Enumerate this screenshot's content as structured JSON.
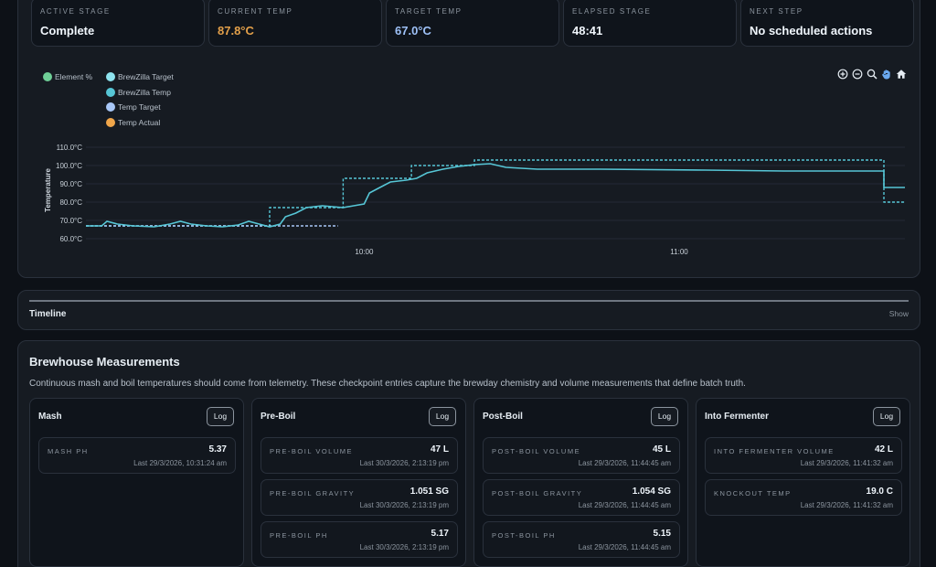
{
  "stats": [
    {
      "label": "Active Stage",
      "value": "Complete",
      "color": "#f0f6fc"
    },
    {
      "label": "Current Temp",
      "value": "87.8°C",
      "color": "#e3a04a"
    },
    {
      "label": "Target Temp",
      "value": "67.0°C",
      "color": "#9ec1f7"
    },
    {
      "label": "Elapsed Stage",
      "value": "48:41",
      "color": "#f0f6fc"
    },
    {
      "label": "Next Step",
      "value": "No scheduled actions",
      "color": "#f0f6fc"
    }
  ],
  "legend": [
    {
      "label": "Element %",
      "color": "#6fcf97"
    },
    {
      "label": "BrewZilla Target",
      "color": "#8ee3ef"
    },
    {
      "label": "BrewZilla Temp",
      "color": "#56c6d6"
    },
    {
      "label": "Temp Target",
      "color": "#a8c7f7"
    },
    {
      "label": "Temp Actual",
      "color": "#f0a64a"
    }
  ],
  "toolbar": {
    "icons": [
      "zoom-in-icon",
      "zoom-out-icon",
      "zoom-select-icon",
      "pan-icon",
      "home-icon"
    ]
  },
  "chart_data": {
    "type": "line",
    "ylabel": "Temperature",
    "ylim": [
      60,
      110
    ],
    "yticks": [
      "110.0°C",
      "100.0°C",
      "90.0°C",
      "80.0°C",
      "70.0°C",
      "60.0°C"
    ],
    "yvalues": [
      110,
      100,
      90,
      80,
      70,
      60
    ],
    "xlim": [
      "09:07",
      "11:43"
    ],
    "xticks": [
      {
        "label": "10:00",
        "t": "10:00"
      },
      {
        "label": "11:00",
        "t": "11:00"
      }
    ],
    "series": [
      {
        "name": "BrewZilla Target",
        "style": "dashed",
        "color": "#56c6d6",
        "points": [
          [
            "09:07",
            67
          ],
          [
            "09:42",
            67
          ],
          [
            "09:42",
            77
          ],
          [
            "09:56",
            77
          ],
          [
            "09:56",
            93
          ],
          [
            "10:09",
            93
          ],
          [
            "10:09",
            100
          ],
          [
            "10:21",
            100
          ],
          [
            "10:21",
            103
          ],
          [
            "11:39",
            103
          ],
          [
            "11:39",
            80
          ],
          [
            "11:43",
            80
          ]
        ]
      },
      {
        "name": "Temp Target",
        "style": "dashed",
        "color": "#a8c7f7",
        "points": [
          [
            "09:07",
            67
          ],
          [
            "09:55",
            67
          ]
        ]
      },
      {
        "name": "BrewZilla Temp",
        "style": "solid",
        "color": "#56c6d6",
        "points": [
          [
            "09:07",
            67
          ],
          [
            "09:10",
            67
          ],
          [
            "09:11",
            69.5
          ],
          [
            "09:13",
            68
          ],
          [
            "09:16",
            67
          ],
          [
            "09:20",
            66.5
          ],
          [
            "09:23",
            68
          ],
          [
            "09:25",
            69.5
          ],
          [
            "09:27",
            68
          ],
          [
            "09:30",
            67
          ],
          [
            "09:33",
            66.5
          ],
          [
            "09:36",
            67.5
          ],
          [
            "09:38",
            69.5
          ],
          [
            "09:40",
            68
          ],
          [
            "09:42",
            66.5
          ],
          [
            "09:44",
            68
          ],
          [
            "09:45",
            72
          ],
          [
            "09:47",
            74
          ],
          [
            "09:49",
            77
          ],
          [
            "09:52",
            78
          ],
          [
            "09:54",
            77.5
          ],
          [
            "09:56",
            77
          ],
          [
            "09:58",
            78
          ],
          [
            "10:00",
            79
          ],
          [
            "10:01",
            85
          ],
          [
            "10:03",
            88
          ],
          [
            "10:05",
            91
          ],
          [
            "10:08",
            92
          ],
          [
            "10:10",
            93
          ],
          [
            "10:12",
            96
          ],
          [
            "10:15",
            98
          ],
          [
            "10:18",
            99.5
          ],
          [
            "10:21",
            100.5
          ],
          [
            "10:24",
            101
          ],
          [
            "10:27",
            99
          ],
          [
            "10:33",
            98
          ],
          [
            "10:45",
            98
          ],
          [
            "11:05",
            97.5
          ],
          [
            "11:20",
            97
          ],
          [
            "11:39",
            97
          ],
          [
            "11:39",
            88
          ],
          [
            "11:43",
            88
          ]
        ]
      }
    ]
  },
  "timeline": {
    "title": "Timeline",
    "toggle": "Show"
  },
  "measurements": {
    "title": "Brewhouse Measurements",
    "description": "Continuous mash and boil temperatures should come from telemetry. These checkpoint entries capture the brewday chemistry and volume measurements that define batch truth.",
    "columns": [
      {
        "title": "Mash",
        "button": "Log",
        "entries": [
          {
            "name": "Mash pH",
            "value": "5.37",
            "time": "Last 29/3/2026, 10:31:24 am"
          }
        ]
      },
      {
        "title": "Pre-Boil",
        "button": "Log",
        "entries": [
          {
            "name": "Pre-Boil Volume",
            "value": "47 L",
            "time": "Last 30/3/2026, 2:13:19 pm"
          },
          {
            "name": "Pre-Boil Gravity",
            "value": "1.051 SG",
            "time": "Last 30/3/2026, 2:13:19 pm"
          },
          {
            "name": "Pre-Boil pH",
            "value": "5.17",
            "time": "Last 30/3/2026, 2:13:19 pm"
          }
        ]
      },
      {
        "title": "Post-Boil",
        "button": "Log",
        "entries": [
          {
            "name": "Post-Boil Volume",
            "value": "45 L",
            "time": "Last 29/3/2026, 11:44:45 am"
          },
          {
            "name": "Post-Boil Gravity",
            "value": "1.054 SG",
            "time": "Last 29/3/2026, 11:44:45 am"
          },
          {
            "name": "Post-Boil pH",
            "value": "5.15",
            "time": "Last 29/3/2026, 11:44:45 am"
          }
        ]
      },
      {
        "title": "Into Fermenter",
        "button": "Log",
        "entries": [
          {
            "name": "Into Fermenter Volume",
            "value": "42 L",
            "time": "Last 29/3/2026, 11:41:32 am"
          },
          {
            "name": "Knockout Temp",
            "value": "19.0 C",
            "time": "Last 29/3/2026, 11:41:32 am"
          }
        ]
      }
    ]
  }
}
